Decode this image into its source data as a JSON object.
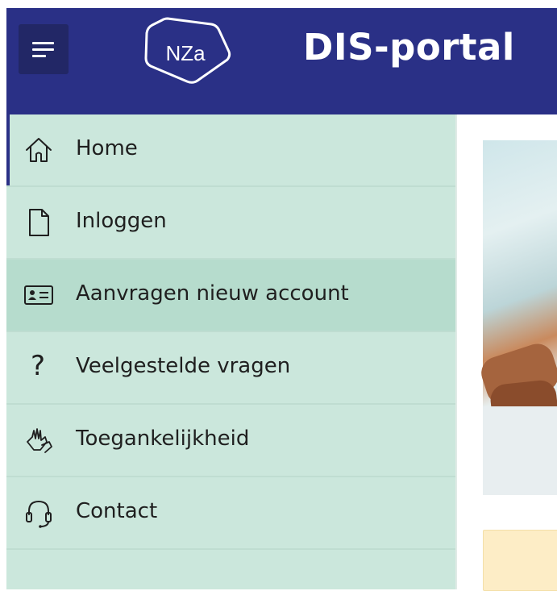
{
  "header": {
    "menu_button": "menu-icon",
    "logo_text": "NZa",
    "title": "DIS-portal",
    "background_color": "#2a3086"
  },
  "sidebar": {
    "background_color": "#cbe7dc",
    "active_color": "#b6dccd",
    "items": [
      {
        "label": "Home",
        "icon": "home-icon"
      },
      {
        "label": "Inloggen",
        "icon": "document-icon"
      },
      {
        "label": "Aanvragen nieuw account",
        "icon": "id-card-icon"
      },
      {
        "label": "Veelgestelde vragen",
        "icon": "question-icon"
      },
      {
        "label": "Toegankelijkheid",
        "icon": "accessibility-hands-icon"
      },
      {
        "label": "Contact",
        "icon": "headset-icon"
      }
    ]
  },
  "content": {
    "notice_color": "#fdedc6"
  }
}
